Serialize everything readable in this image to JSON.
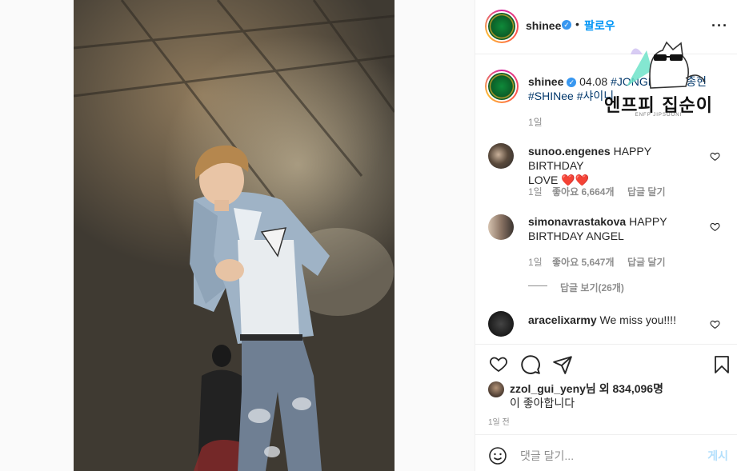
{
  "post": {
    "author": "shinee",
    "follow_label": "팔로우",
    "dot": "•",
    "more_label": "···",
    "caption_date": "04.08",
    "caption_tags": [
      "#JONGHYUN",
      "#종현",
      "#SHINee",
      "#샤이니"
    ],
    "caption_time": "1일"
  },
  "comments": [
    {
      "user": "sunoo.engenes",
      "text": "HAPPY BIRTHDAY",
      "text2": "LOVE ❤️❤️",
      "time": "1일",
      "likes": "좋아요 6,664개",
      "reply": "답글 달기"
    },
    {
      "user": "simonavrastakova",
      "text": "HAPPY",
      "text2": "BIRTHDAY ANGEL",
      "time": "1일",
      "likes": "좋아요 5,647개",
      "reply": "답글 달기",
      "view_replies": "답글 보기(26개)"
    },
    {
      "user": "aracelixarmy",
      "text": "We miss you!!!!",
      "time": "",
      "likes": "",
      "reply": ""
    }
  ],
  "likes": {
    "user": "zzol_gui_yeny",
    "suffix": "님 외 834,096명",
    "line2": "이 좋아합니다"
  },
  "timestamp": "1일 전",
  "add_comment": {
    "placeholder": "댓글 달기...",
    "post_label": "게시"
  },
  "watermark": {
    "title": "엔프피 집순이",
    "subtitle": "ENFP JIPSOONI"
  },
  "colors": {
    "accent": "#0095f6",
    "heart": "#ed4956",
    "hashtag": "#00376b",
    "muted": "#8e8e8e"
  }
}
